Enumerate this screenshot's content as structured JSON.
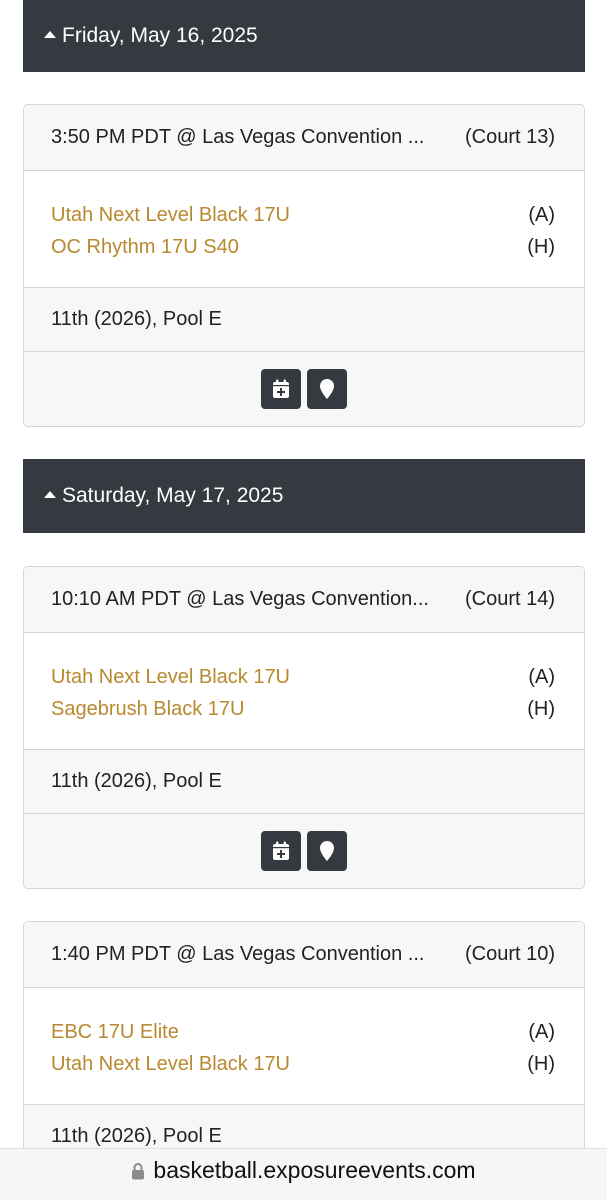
{
  "days": [
    {
      "label": "Friday, May 16, 2025"
    },
    {
      "label": "Saturday, May 17, 2025"
    }
  ],
  "games": [
    {
      "time_location": "3:50 PM PDT @ Las Vegas Convention ...",
      "court": "(Court 13)",
      "away_team": "Utah Next Level Black 17U",
      "away_side": "(A)",
      "home_team": "OC Rhythm 17U S40",
      "home_side": "(H)",
      "pool": "11th (2026), Pool E"
    },
    {
      "time_location": "10:10 AM PDT @ Las Vegas Convention...",
      "court": "(Court 14)",
      "away_team": "Utah Next Level Black 17U",
      "away_side": "(A)",
      "home_team": "Sagebrush Black 17U",
      "home_side": "(H)",
      "pool": "11th (2026), Pool E"
    },
    {
      "time_location": "1:40 PM PDT @ Las Vegas Convention ...",
      "court": "(Court 10)",
      "away_team": "EBC 17U Elite",
      "away_side": "(A)",
      "home_team": "Utah Next Level Black 17U",
      "home_side": "(H)",
      "pool": "11th (2026), Pool E"
    }
  ],
  "icons": {
    "collapse": "caret-up-icon",
    "calendar": "calendar-plus-icon",
    "location": "map-marker-icon",
    "lock": "lock-icon"
  },
  "colors": {
    "header_bg": "#343a40",
    "team_link": "#b8892f"
  },
  "browser": {
    "url": "basketball.exposureevents.com"
  }
}
